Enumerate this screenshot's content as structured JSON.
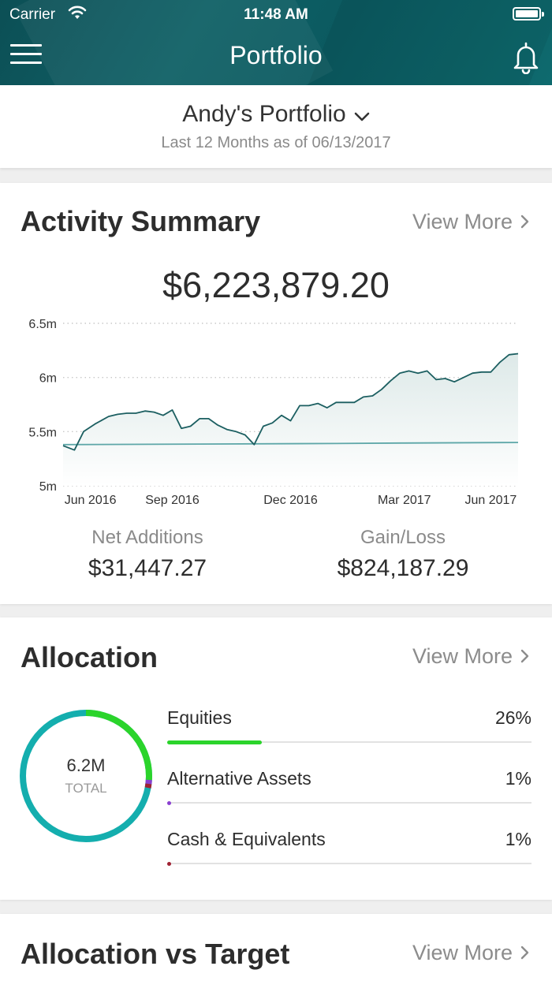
{
  "status_bar": {
    "carrier": "Carrier",
    "time": "11:48 AM"
  },
  "nav": {
    "title": "Portfolio"
  },
  "portfolio": {
    "name": "Andy's Portfolio",
    "subtitle": "Last 12 Months as of 06/13/2017"
  },
  "activity": {
    "title": "Activity Summary",
    "view_more": "View More",
    "total": "$6,223,879.20",
    "net_additions_label": "Net Additions",
    "net_additions_value": "$31,447.27",
    "gain_loss_label": "Gain/Loss",
    "gain_loss_value": "$824,187.29"
  },
  "chart_data": {
    "type": "area",
    "y_tick_labels": [
      "6.5m",
      "6m",
      "5.5m",
      "5m"
    ],
    "y_ticks": [
      6.5,
      6.0,
      5.5,
      5.0
    ],
    "ylim": [
      5.0,
      6.5
    ],
    "x_tick_labels": [
      "Jun 2016",
      "Sep 2016",
      "Dec 2016",
      "Mar 2017",
      "Jun 2017"
    ],
    "x_tick_positions": [
      0.06,
      0.24,
      0.5,
      0.75,
      0.94
    ],
    "grid": "horizontal dotted",
    "series": [
      {
        "x": [
          0.0,
          0.025,
          0.045,
          0.07,
          0.1,
          0.12,
          0.14,
          0.16,
          0.18,
          0.2,
          0.22,
          0.24,
          0.26,
          0.28,
          0.3,
          0.32,
          0.34,
          0.36,
          0.38,
          0.4,
          0.42,
          0.44,
          0.46,
          0.48,
          0.5,
          0.52,
          0.54,
          0.56,
          0.58,
          0.6,
          0.62,
          0.64,
          0.66,
          0.68,
          0.7,
          0.72,
          0.74,
          0.76,
          0.78,
          0.8,
          0.82,
          0.84,
          0.86,
          0.88,
          0.9,
          0.92,
          0.94,
          0.96,
          0.98,
          1.0
        ],
        "values": [
          5.37,
          5.33,
          5.5,
          5.57,
          5.64,
          5.66,
          5.67,
          5.67,
          5.69,
          5.68,
          5.65,
          5.7,
          5.53,
          5.55,
          5.62,
          5.62,
          5.56,
          5.52,
          5.5,
          5.47,
          5.38,
          5.55,
          5.58,
          5.65,
          5.6,
          5.74,
          5.74,
          5.76,
          5.72,
          5.77,
          5.77,
          5.77,
          5.82,
          5.83,
          5.89,
          5.97,
          6.04,
          6.06,
          6.04,
          6.06,
          5.98,
          5.99,
          5.96,
          6.0,
          6.04,
          6.05,
          6.05,
          6.14,
          6.21,
          6.22
        ]
      },
      {
        "x": [
          0.0,
          0.3,
          0.6,
          0.75,
          1.0
        ],
        "values": [
          5.38,
          5.385,
          5.39,
          5.395,
          5.4
        ]
      }
    ],
    "colors": {
      "value_line": "#1c5f61",
      "net_line": "#5ea7a8",
      "area_top": "#dde9e8"
    }
  },
  "allocation": {
    "title": "Allocation",
    "view_more": "View More",
    "donut_total": "6.2M",
    "donut_label": "TOTAL",
    "rows": [
      {
        "name": "Equities",
        "pct": "26%",
        "fraction": 0.26,
        "color": "#2bd42b"
      },
      {
        "name": "Alternative Assets",
        "pct": "1%",
        "fraction": 0.01,
        "color": "#8a3fd1"
      },
      {
        "name": "Cash & Equivalents",
        "pct": "1%",
        "fraction": 0.01,
        "color": "#a02233"
      }
    ],
    "donut_main_color": "#14aeae"
  },
  "target": {
    "title": "Allocation vs Target",
    "view_more": "View More"
  }
}
